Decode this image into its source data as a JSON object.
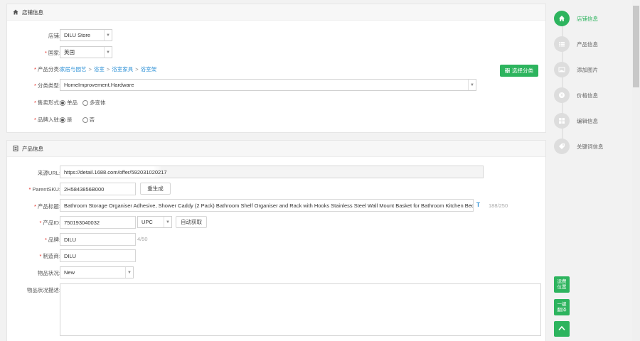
{
  "store_section": {
    "title": "店铺信息",
    "store": {
      "label": "店铺:",
      "value": "DILU Store"
    },
    "country": {
      "label": "国家:",
      "value": "英国"
    },
    "category": {
      "label": "产品分类:",
      "path": [
        "家居与园艺",
        "浴室",
        "浴室家具",
        "浴室架"
      ],
      "separator": ">"
    },
    "choose_category_button": "选择分类",
    "category_type": {
      "label": "分类类型:",
      "value": "HomeImprovement.Hardware"
    },
    "sale_form": {
      "label": "售卖形式:",
      "options": [
        "单品",
        "多变体"
      ],
      "selected": 0
    },
    "brand_registry": {
      "label": "品牌入驻:",
      "options": [
        "是",
        "否"
      ],
      "selected": 0
    }
  },
  "product_section": {
    "title": "产品信息",
    "source_url": {
      "label": "来源URL:",
      "value": "https://detail.1688.com/offer/592031020217"
    },
    "parent_sku": {
      "label": "ParentSKU:",
      "value": "2H5843856B000",
      "generate_button": "重生成"
    },
    "product_title": {
      "label": "产品标题:",
      "value": "Bathroom Storage Organiser Adhesive, Shower Caddy (2 Pack) Bathroom Shelf Organiser and Rack with Hooks Stainless Steel Wall Mount Basket for Bathroom Kitchen Bedroom R",
      "translate_icon": "T",
      "count": "188/250"
    },
    "product_id": {
      "label": "产品ID:",
      "value": "750193040032",
      "type": "UPC",
      "auto_button": "自动获取"
    },
    "brand": {
      "label": "品牌:",
      "value": "DILU",
      "count": "4/50"
    },
    "manufacturer": {
      "label": "制造商:",
      "value": "DILU"
    },
    "condition": {
      "label": "物品状况:",
      "value": "New"
    },
    "condition_desc": {
      "label": "物品状况描述:",
      "value": ""
    }
  },
  "steps": [
    {
      "label": "店铺信息",
      "icon": "home-icon",
      "active": true
    },
    {
      "label": "产品信息",
      "icon": "list-icon",
      "active": false
    },
    {
      "label": "添加图片",
      "icon": "image-icon",
      "active": false
    },
    {
      "label": "价格信息",
      "icon": "price-icon",
      "active": false
    },
    {
      "label": "编辑信息",
      "icon": "grid-icon",
      "active": false
    },
    {
      "label": "关键词信息",
      "icon": "tag-icon",
      "active": false
    }
  ],
  "side_buttons": {
    "location": "运费\n位置",
    "translate": "一键\n翻译"
  },
  "colors": {
    "accent": "#2db45e",
    "link": "#2a8fd6",
    "required": "#e2231a"
  }
}
